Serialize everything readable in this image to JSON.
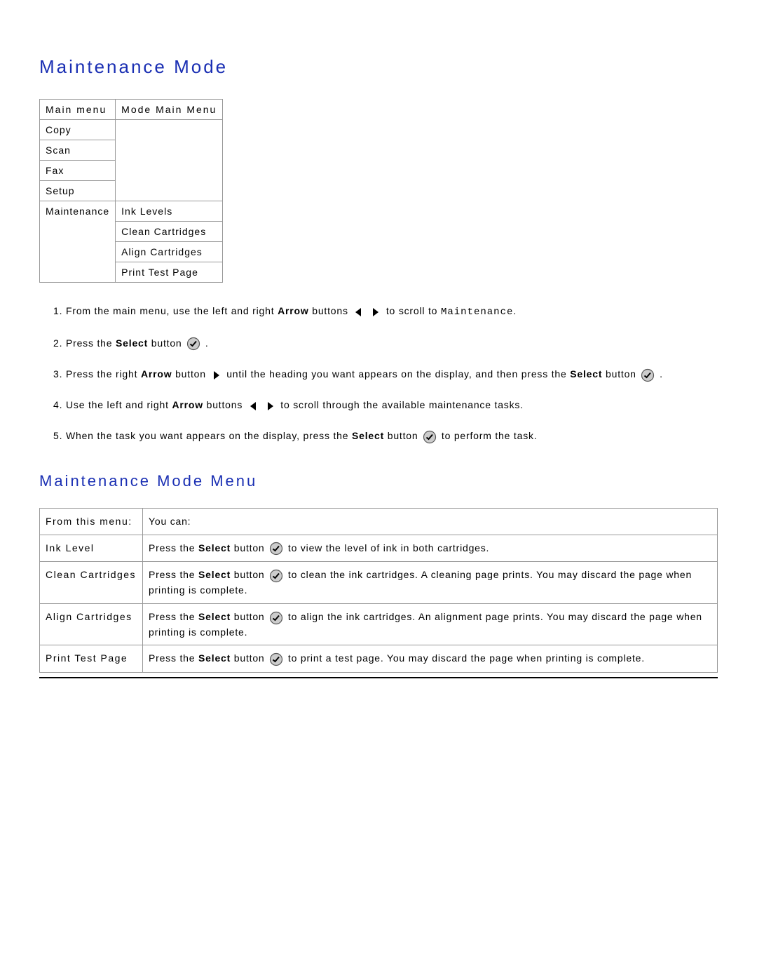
{
  "title": "Maintenance Mode",
  "menuTable": {
    "header": {
      "col1": "Main menu",
      "col2": "Mode Main Menu"
    },
    "rows": {
      "copy": "Copy",
      "scan": "Scan",
      "fax": "Fax",
      "setup": "Setup",
      "maintenance": "Maintenance",
      "inkLevels": "Ink Levels",
      "cleanCartridges": "Clean Cartridges",
      "alignCartridges": "Align Cartridges",
      "printTestPage": "Print Test Page"
    }
  },
  "steps": {
    "s1a": "From the main menu, use the left and right ",
    "s1b": "Arrow",
    "s1c": " buttons ",
    "s1d": " to scroll to ",
    "s1e": "Maintenance",
    "s1f": ".",
    "s2a": "Press the ",
    "s2b": "Select",
    "s2c": " button ",
    "s2d": " .",
    "s3a": "Press the right ",
    "s3b": "Arrow",
    "s3c": " button ",
    "s3d": " until the heading you want appears on the display, and then press the ",
    "s3e": "Select",
    "s3f": " button ",
    "s3g": " .",
    "s4a": "Use the left and right ",
    "s4b": "Arrow",
    "s4c": " buttons ",
    "s4d": " to scroll through the available maintenance tasks.",
    "s5a": "When the task you want appears on the display, press the ",
    "s5b": "Select",
    "s5c": " button ",
    "s5d": " to perform the task."
  },
  "subTitle": "Maintenance Mode Menu",
  "descTable": {
    "header": {
      "left": "From this menu:",
      "right": "You can:"
    },
    "r1": {
      "left": "Ink Level",
      "a": "Press the ",
      "b": "Select",
      "c": " button ",
      "d": " to view the level of ink in both cartridges."
    },
    "r2": {
      "left": "Clean Cartridges",
      "a": "Press the ",
      "b": "Select",
      "c": " button ",
      "d": " to clean the ink cartridges. A cleaning page prints. You may discard the page when printing is complete."
    },
    "r3": {
      "left": "Align Cartridges",
      "a": "Press the ",
      "b": "Select",
      "c": " button ",
      "d": " to align the ink cartridges. An alignment page prints. You may discard the page when printing is complete."
    },
    "r4": {
      "left": "Print Test Page",
      "a": "Press the ",
      "b": "Select",
      "c": " button ",
      "d": " to print a test page. You may discard the page when printing is complete."
    }
  }
}
